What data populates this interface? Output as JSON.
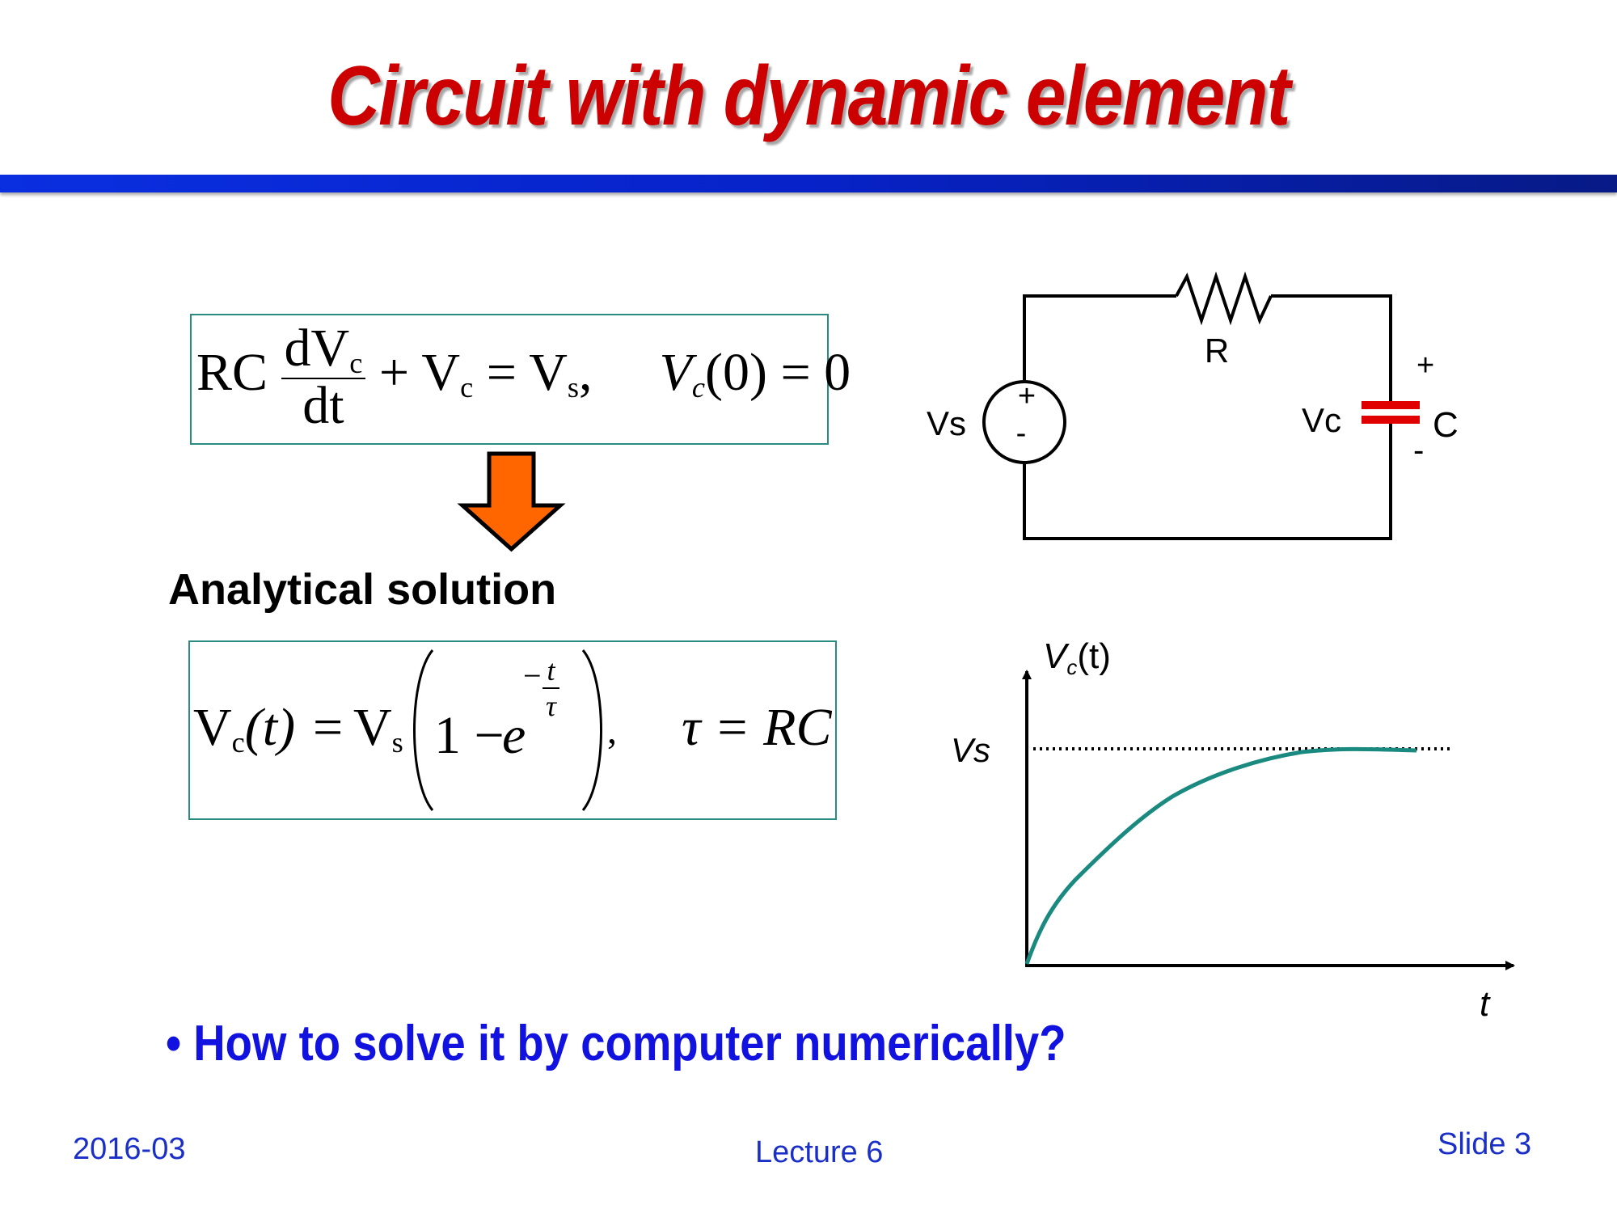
{
  "slide": {
    "title": "Circuit with dynamic element",
    "section_label": "Analytical solution",
    "bullet": "How to solve it by computer numerically?",
    "bullet_marker": "•",
    "footer_left": "2016-03",
    "footer_center": "Lecture 6",
    "footer_right": "Slide 3"
  },
  "equation1": {
    "rc": "RC",
    "dv": "dV",
    "dv_sub": "c",
    "dt": "dt",
    "plus": "+",
    "vc": "V",
    "vc_sub": "c",
    "eq": "=",
    "vs": "V",
    "vs_sub": "s",
    "comma": ",",
    "ic_v": "V",
    "ic_sub": "c",
    "ic_rest": "(0) = 0"
  },
  "equation2": {
    "lhs_v": "V",
    "lhs_sub": "c",
    "lhs_arg": "(t)",
    "eq": "=",
    "vs": "V",
    "vs_sub": "s",
    "one_minus": "1 −",
    "e": "e",
    "exp_minus": "−",
    "exp_num": "t",
    "exp_den": "τ",
    "comma": ",",
    "tau_def": "τ = RC"
  },
  "circuit": {
    "source_label": "Vs",
    "source_plus": "+",
    "source_minus": "-",
    "resistor_label": "R",
    "cap_voltage_label": "Vc",
    "cap_label": "C",
    "cap_plus": "+",
    "cap_minus": "-"
  },
  "graph": {
    "y_label_v": "V",
    "y_label_sub": "c",
    "y_label_arg": "(t)",
    "vs_label": "Vs",
    "x_label": "t"
  },
  "colors": {
    "title": "#cc0000",
    "title_bar": "#0722c8",
    "arrow_fill": "#ff6600",
    "capacitor": "#e00000",
    "curve": "#1a8a80",
    "bullet": "#1212e0",
    "footer": "#1a2fc8"
  }
}
